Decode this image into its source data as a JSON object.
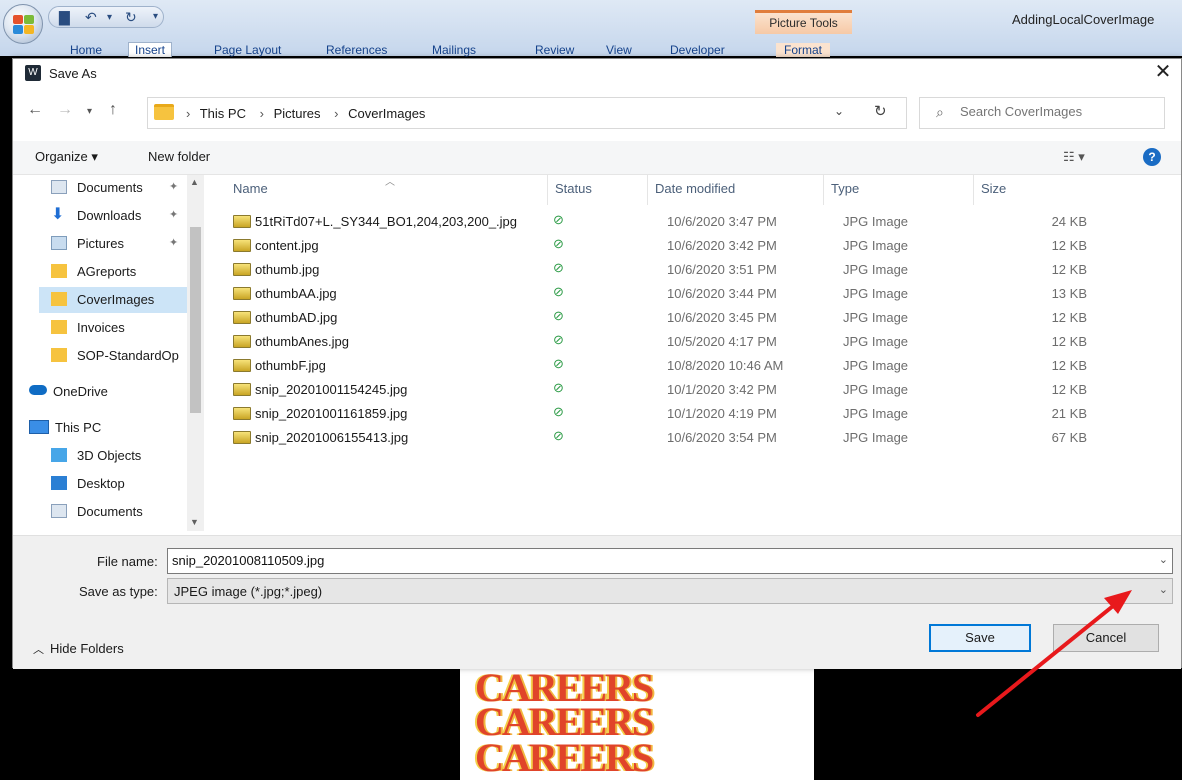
{
  "word": {
    "tabs": [
      "Home",
      "Insert",
      "Page Layout",
      "References",
      "Mailings",
      "Review",
      "View",
      "Developer",
      "Format"
    ],
    "picture_tools": "Picture Tools",
    "doc_title": "AddingLocalCoverImage"
  },
  "background_image": {
    "text": "CAREERS"
  },
  "dialog": {
    "title": "Save As",
    "address": {
      "crumbs": [
        "This PC",
        "Pictures",
        "CoverImages"
      ]
    },
    "search_placeholder": "Search CoverImages",
    "toolbar": {
      "organize": "Organize ▾",
      "new_folder": "New folder"
    },
    "nav_items": [
      {
        "label": "Documents",
        "pinned": true
      },
      {
        "label": "Downloads",
        "pinned": true
      },
      {
        "label": "Pictures",
        "pinned": true
      },
      {
        "label": "AGreports",
        "pinned": false
      },
      {
        "label": "CoverImages",
        "pinned": false,
        "selected": true
      },
      {
        "label": "Invoices",
        "pinned": false
      },
      {
        "label": "SOP-StandardOp",
        "pinned": false
      },
      {
        "label": "OneDrive",
        "pinned": false
      },
      {
        "label": "This PC",
        "pinned": false
      },
      {
        "label": "3D Objects",
        "pinned": false
      },
      {
        "label": "Desktop",
        "pinned": false
      },
      {
        "label": "Documents",
        "pinned": false
      }
    ],
    "columns": [
      "Name",
      "Status",
      "Date modified",
      "Type",
      "Size"
    ],
    "files": [
      {
        "name": "51tRiTd07+L._SY344_BO1,204,203,200_.jpg",
        "date": "10/6/2020 3:47 PM",
        "type": "JPG Image",
        "size": "24 KB"
      },
      {
        "name": "content.jpg",
        "date": "10/6/2020 3:42 PM",
        "type": "JPG Image",
        "size": "12 KB"
      },
      {
        "name": "othumb.jpg",
        "date": "10/6/2020 3:51 PM",
        "type": "JPG Image",
        "size": "12 KB"
      },
      {
        "name": "othumbAA.jpg",
        "date": "10/6/2020 3:44 PM",
        "type": "JPG Image",
        "size": "13 KB"
      },
      {
        "name": "othumbAD.jpg",
        "date": "10/6/2020 3:45 PM",
        "type": "JPG Image",
        "size": "12 KB"
      },
      {
        "name": "othumbAnes.jpg",
        "date": "10/5/2020 4:17 PM",
        "type": "JPG Image",
        "size": "12 KB"
      },
      {
        "name": "othumbF.jpg",
        "date": "10/8/2020 10:46 AM",
        "type": "JPG Image",
        "size": "12 KB"
      },
      {
        "name": "snip_20201001154245.jpg",
        "date": "10/1/2020 3:42 PM",
        "type": "JPG Image",
        "size": "12 KB"
      },
      {
        "name": "snip_20201001161859.jpg",
        "date": "10/1/2020 4:19 PM",
        "type": "JPG Image",
        "size": "21 KB"
      },
      {
        "name": "snip_20201006155413.jpg",
        "date": "10/6/2020 3:54 PM",
        "type": "JPG Image",
        "size": "67 KB"
      }
    ],
    "file_name_label": "File name:",
    "file_name_value": "snip_20201008110509.jpg",
    "save_type_label": "Save as type:",
    "save_type_value": "JPEG image (*.jpg;*.jpeg)",
    "hide_folders": "Hide Folders",
    "save_label": "Save",
    "cancel_label": "Cancel"
  },
  "colors": {
    "accent": "#0078d7",
    "selected": "#cce4f7",
    "annotation_arrow": "#e8191c"
  }
}
